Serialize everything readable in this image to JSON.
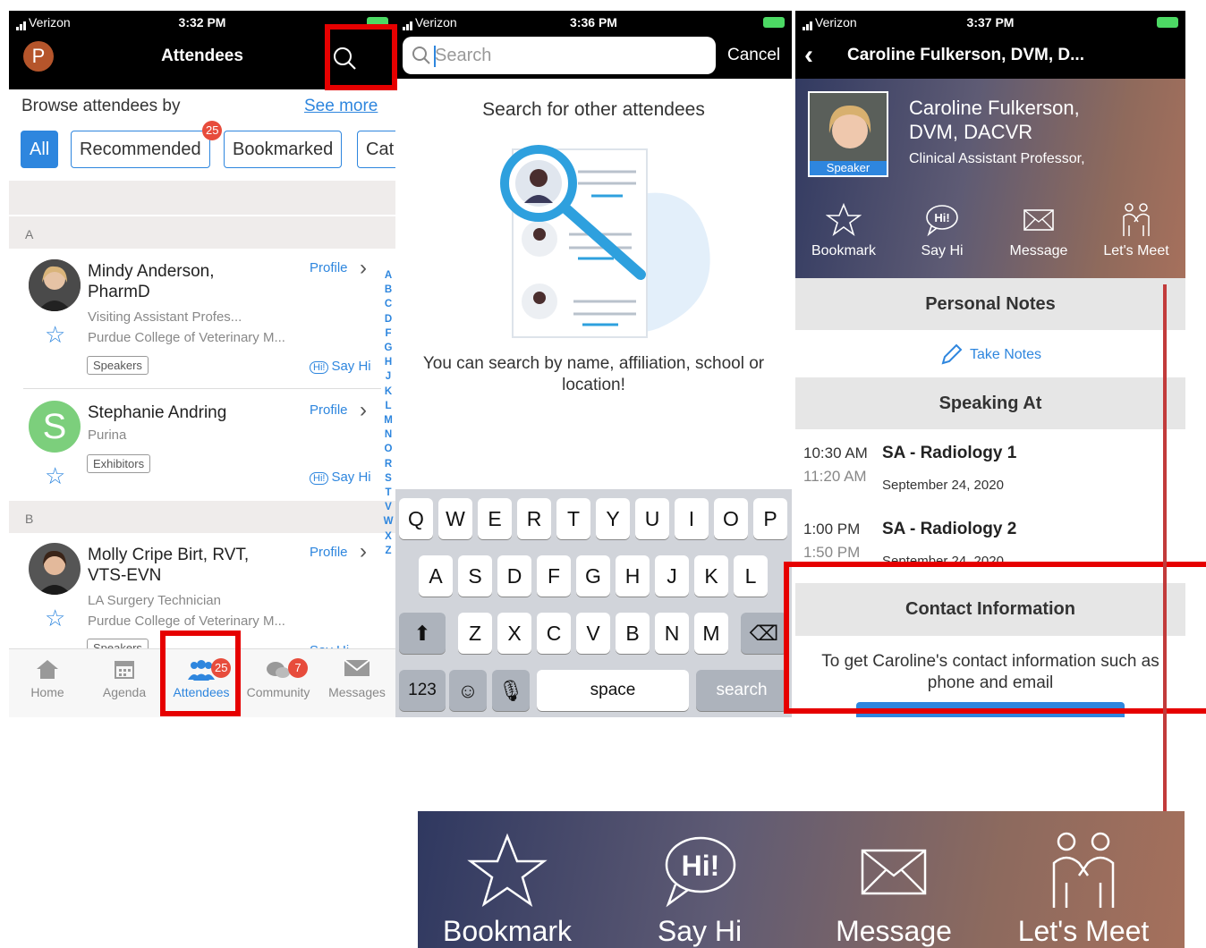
{
  "colors": {
    "accent": "#2e86de",
    "highlight": "#e60000",
    "badge": "#e74c3c"
  },
  "screen1": {
    "status": {
      "carrier": "Verizon",
      "time": "3:32 PM"
    },
    "avatar_letter": "P",
    "title": "Attendees",
    "browse_label": "Browse attendees by",
    "see_more": "See more",
    "chips": [
      "All",
      "Recommended",
      "Bookmarked",
      "Cat"
    ],
    "recommended_badge": "25",
    "sections": [
      "A",
      "B"
    ],
    "people": [
      {
        "name1": "Mindy Anderson,",
        "name2": "PharmD",
        "sub1": "Visiting Assistant Profes...",
        "sub2": "Purdue College of Veterinary M...",
        "tag": "Speakers",
        "profile": "Profile",
        "sayhi": "Say Hi"
      },
      {
        "name1": "Stephanie Andring",
        "sub1": "Purina",
        "tag": "Exhibitors",
        "profile": "Profile",
        "sayhi": "Say Hi",
        "initial": "S"
      },
      {
        "name1": "Molly Cripe Birt, RVT,",
        "name2": "VTS-EVN",
        "sub1": "LA Surgery Technician",
        "sub2": "Purdue College of Veterinary M...",
        "tag": "Speakers",
        "profile": "Profile",
        "sayhi": "Say Hi"
      }
    ],
    "index_letters": [
      "A",
      "B",
      "C",
      "D",
      "F",
      "G",
      "H",
      "J",
      "K",
      "L",
      "M",
      "N",
      "O",
      "R",
      "S",
      "T",
      "V",
      "W",
      "X",
      "Z"
    ],
    "tabs": [
      {
        "label": "Home",
        "icon": "home-icon"
      },
      {
        "label": "Agenda",
        "icon": "calendar-icon"
      },
      {
        "label": "Attendees",
        "icon": "people-icon",
        "badge": "25"
      },
      {
        "label": "Community",
        "icon": "chat-icon",
        "badge": "7"
      },
      {
        "label": "Messages",
        "icon": "envelope-icon"
      }
    ]
  },
  "screen2": {
    "status": {
      "carrier": "Verizon",
      "time": "3:36 PM"
    },
    "search_placeholder": "Search",
    "cancel": "Cancel",
    "title": "Search for other attendees",
    "description": "You can search by name, affiliation, school or location!",
    "keyboard": {
      "row1": [
        "Q",
        "W",
        "E",
        "R",
        "T",
        "Y",
        "U",
        "I",
        "O",
        "P"
      ],
      "row2": [
        "A",
        "S",
        "D",
        "F",
        "G",
        "H",
        "J",
        "K",
        "L"
      ],
      "row3": [
        "Z",
        "X",
        "C",
        "V",
        "B",
        "N",
        "M"
      ],
      "num": "123",
      "space": "space",
      "search": "search"
    }
  },
  "screen3": {
    "status": {
      "carrier": "Verizon",
      "time": "3:37 PM"
    },
    "nav_title": "Caroline Fulkerson, DVM, D...",
    "name_line1": "Caroline Fulkerson,",
    "name_line2": "DVM, DACVR",
    "subtitle": "Clinical Assistant Professor,",
    "speaker_tag": "Speaker",
    "actions": [
      {
        "label": "Bookmark",
        "icon": "star-icon"
      },
      {
        "label": "Say Hi",
        "icon": "say-hi-icon"
      },
      {
        "label": "Message",
        "icon": "envelope-icon"
      },
      {
        "label": "Let's Meet",
        "icon": "meet-icon"
      }
    ],
    "personal_notes": "Personal Notes",
    "take_notes": "Take Notes",
    "speaking_at": "Speaking At",
    "sessions": [
      {
        "start": "10:30 AM",
        "end": "11:20 AM",
        "title": "SA - Radiology 1",
        "date": "September 24, 2020"
      },
      {
        "start": "1:00 PM",
        "end": "1:50 PM",
        "title": "SA - Radiology 2",
        "date": "September 24, 2020"
      }
    ],
    "contact_title": "Contact Information",
    "contact_text": "To get Caroline's contact information such as phone and email"
  },
  "zoom": {
    "actions": [
      "Bookmark",
      "Say Hi",
      "Message",
      "Let's Meet"
    ]
  }
}
